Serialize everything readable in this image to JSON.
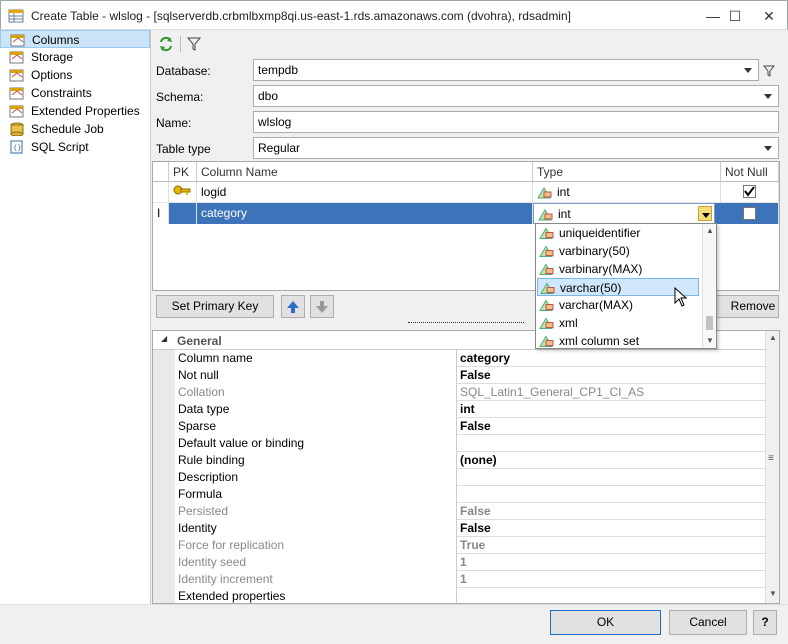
{
  "window": {
    "title": "Create Table - wlslog - [sqlserverdb.crbmlbxmp8qi.us-east-1.rds.amazonaws.com (dvohra), rdsadmin]",
    "minimize": "—",
    "maximize": "☐",
    "close": "✕"
  },
  "sidebar": {
    "items": [
      {
        "label": "Columns",
        "icon": "columns-icon"
      },
      {
        "label": "Storage",
        "icon": "storage-icon"
      },
      {
        "label": "Options",
        "icon": "options-icon"
      },
      {
        "label": "Constraints",
        "icon": "constraints-icon"
      },
      {
        "label": "Extended Properties",
        "icon": "extended-properties-icon"
      },
      {
        "label": "Schedule Job",
        "icon": "schedule-job-icon"
      },
      {
        "label": "SQL Script",
        "icon": "sql-script-icon"
      }
    ]
  },
  "form": {
    "database_label": "Database:",
    "database_value": "tempdb",
    "schema_label": "Schema:",
    "schema_value": "dbo",
    "name_label": "Name:",
    "name_value": "wlslog",
    "table_type_label": "Table type",
    "table_type_value": "Regular"
  },
  "grid": {
    "headers": {
      "pk": "PK",
      "name": "Column Name",
      "type": "Type",
      "notnull": "Not Null"
    },
    "rows": [
      {
        "name": "logid",
        "type": "int",
        "pk": true,
        "notnull": true
      },
      {
        "name": "category",
        "type": "int",
        "pk": false,
        "notnull": false
      }
    ],
    "row_cursor": "I"
  },
  "buttons": {
    "set_primary_key": "Set Primary Key",
    "remove": "Remove",
    "ok": "OK",
    "cancel": "Cancel",
    "help": "?"
  },
  "dropdown": {
    "items": [
      "uniqueidentifier",
      "varbinary(50)",
      "varbinary(MAX)",
      "varchar(50)",
      "varchar(MAX)",
      "xml",
      "xml column set"
    ],
    "highlighted": "varchar(50)"
  },
  "properties": {
    "section": "General",
    "rows": [
      {
        "name": "Column name",
        "value": "category",
        "bold": true,
        "disabled": false
      },
      {
        "name": "Not null",
        "value": "False",
        "bold": true,
        "disabled": false
      },
      {
        "name": "Collation",
        "value": "SQL_Latin1_General_CP1_CI_AS",
        "bold": false,
        "disabled": true
      },
      {
        "name": "Data type",
        "value": "int",
        "bold": true,
        "disabled": false
      },
      {
        "name": "Sparse",
        "value": "False",
        "bold": true,
        "disabled": false
      },
      {
        "name": "Default value or binding",
        "value": "",
        "bold": false,
        "disabled": false
      },
      {
        "name": "Rule binding",
        "value": "(none)",
        "bold": true,
        "disabled": false
      },
      {
        "name": "Description",
        "value": "",
        "bold": false,
        "disabled": false
      },
      {
        "name": "Formula",
        "value": "",
        "bold": false,
        "disabled": false
      },
      {
        "name": "Persisted",
        "value": "False",
        "bold": true,
        "disabled": true
      },
      {
        "name": "Identity",
        "value": "False",
        "bold": true,
        "disabled": false
      },
      {
        "name": "Force for replication",
        "value": "True",
        "bold": true,
        "disabled": true
      },
      {
        "name": "Identity seed",
        "value": "1",
        "bold": true,
        "disabled": true
      },
      {
        "name": "Identity increment",
        "value": "1",
        "bold": true,
        "disabled": true
      },
      {
        "name": "Extended properties",
        "value": "",
        "bold": false,
        "disabled": false
      }
    ]
  },
  "colors": {
    "selection": "#3d73b9",
    "highlight": "#cfe6fb",
    "accent": "#1a6fc4"
  }
}
